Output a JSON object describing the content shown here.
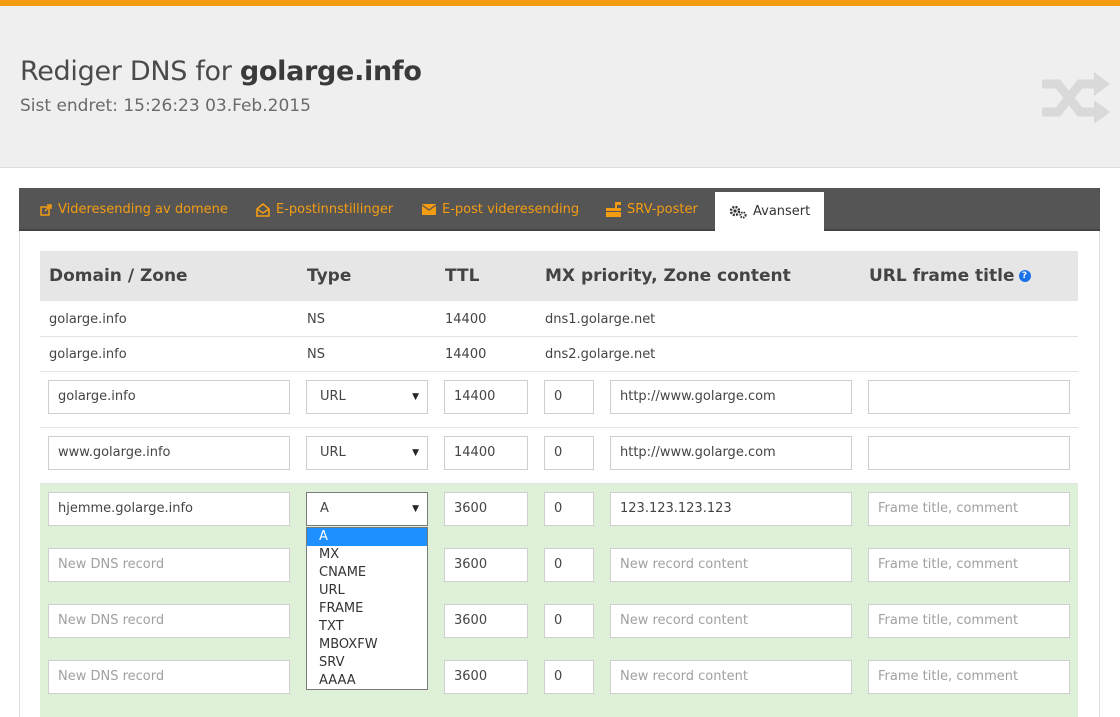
{
  "header": {
    "title_prefix": "Rediger DNS for ",
    "domain": "golarge.info",
    "last_changed": "Sist endret: 15:26:23 03.Feb.2015"
  },
  "tabs": [
    {
      "label": "Videresending av domene",
      "icon": "external-link-icon"
    },
    {
      "label": "E-postinnstillinger",
      "icon": "envelope-open-icon"
    },
    {
      "label": "E-post videresending",
      "icon": "envelope-icon"
    },
    {
      "label": "SRV-poster",
      "icon": "mailbox-icon"
    },
    {
      "label": "Avansert",
      "icon": "gears-icon"
    }
  ],
  "table": {
    "headers": [
      "Domain / Zone",
      "Type",
      "TTL",
      "MX priority, Zone content",
      "URL frame title"
    ],
    "static_rows": [
      {
        "domain": "golarge.info",
        "type": "NS",
        "ttl": "14400",
        "content": "dns1.golarge.net"
      },
      {
        "domain": "golarge.info",
        "type": "NS",
        "ttl": "14400",
        "content": "dns2.golarge.net"
      }
    ],
    "edit_rows": [
      {
        "domain": "golarge.info",
        "type": "URL",
        "ttl": "14400",
        "mx": "0",
        "content": "http://www.golarge.com",
        "frame": ""
      },
      {
        "domain": "www.golarge.info",
        "type": "URL",
        "ttl": "14400",
        "mx": "0",
        "content": "http://www.golarge.com",
        "frame": ""
      },
      {
        "domain": "hjemme.golarge.info",
        "type": "A",
        "ttl": "3600",
        "mx": "0",
        "content": "123.123.123.123",
        "frame": ""
      }
    ],
    "new_rows": [
      {
        "ttl": "3600",
        "mx": "0"
      },
      {
        "ttl": "3600",
        "mx": "0"
      },
      {
        "ttl": "3600",
        "mx": "0"
      }
    ],
    "placeholders": {
      "domain": "New DNS record",
      "content": "New record content",
      "frame": "Frame title, comment"
    }
  },
  "type_options": [
    "A",
    "MX",
    "CNAME",
    "URL",
    "FRAME",
    "TXT",
    "MBOXFW",
    "SRV",
    "AAAA"
  ],
  "type_selected": "A",
  "colors": {
    "accent": "#f39c12",
    "tabbar": "#555555",
    "new_rows": "#dff0d8",
    "option_highlight": "#1e90ff"
  }
}
